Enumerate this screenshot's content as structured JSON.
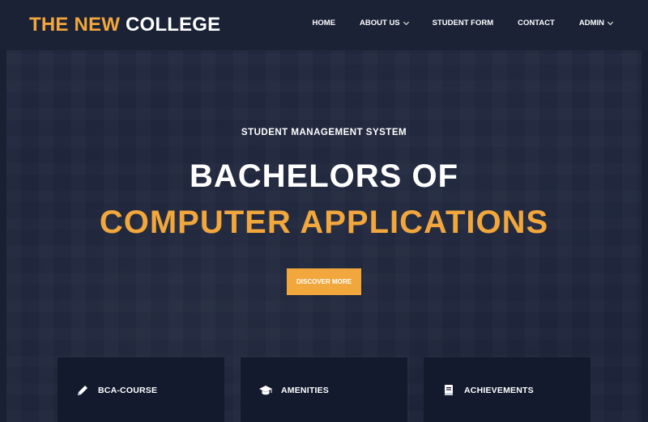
{
  "brand": {
    "accent": "THE NEW",
    "plain": "COLLEGE"
  },
  "nav": {
    "items": [
      {
        "label": "HOME",
        "has_dropdown": false
      },
      {
        "label": "ABOUT US",
        "has_dropdown": true
      },
      {
        "label": "STUDENT FORM",
        "has_dropdown": false
      },
      {
        "label": "CONTACT",
        "has_dropdown": false
      },
      {
        "label": "ADMIN",
        "has_dropdown": true
      }
    ]
  },
  "hero": {
    "subtitle": "STUDENT MANAGEMENT SYSTEM",
    "title_line1": "BACHELORS OF",
    "title_line2": "COMPUTER APPLICATIONS",
    "cta_label": "DISCOVER MORE"
  },
  "cards": [
    {
      "label": "BCA-COURSE",
      "icon": "pencil-icon"
    },
    {
      "label": "AMENITIES",
      "icon": "graduation-cap-icon"
    },
    {
      "label": "ACHIEVEMENTS",
      "icon": "book-icon"
    }
  ],
  "colors": {
    "accent": "#f2a73c",
    "header_bg": "#1b2236",
    "card_bg": "#141a2e",
    "text": "#ffffff"
  }
}
